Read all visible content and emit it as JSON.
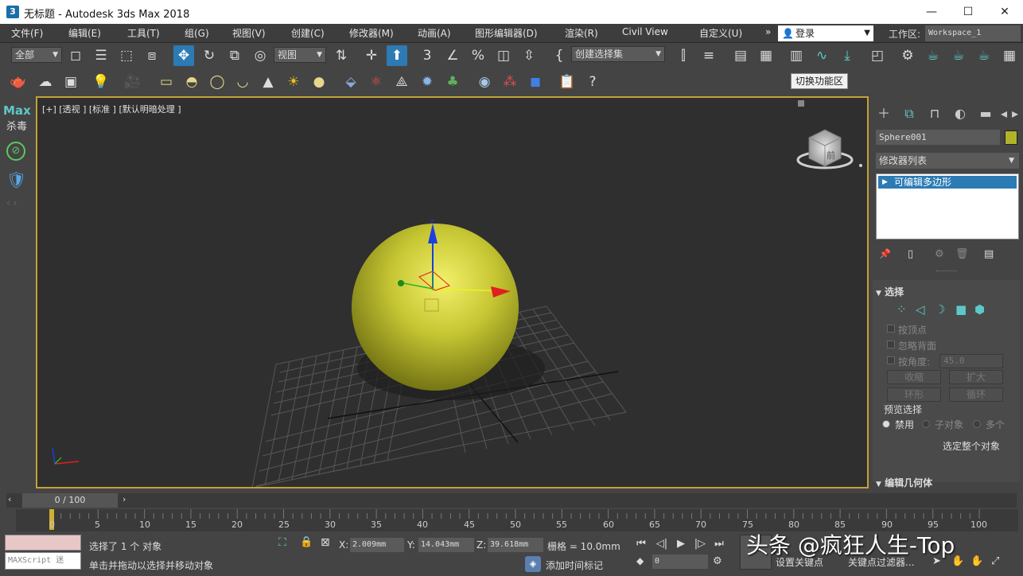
{
  "window": {
    "title": "无标题 - Autodesk 3ds Max 2018",
    "app_icon_text": "3"
  },
  "menu": [
    "文件(F)",
    "编辑(E)",
    "工具(T)",
    "组(G)",
    "视图(V)",
    "创建(C)",
    "修改器(M)",
    "动画(A)",
    "图形编辑器(D)",
    "渲染(R)",
    "Civil View",
    "自定义(U)"
  ],
  "menu_overflow": "»",
  "login": {
    "label": "登录"
  },
  "workspace": {
    "label": "工作区:",
    "value": "Workspace_1"
  },
  "toolbar": {
    "selection_filter": "全部",
    "reference_coord": "视图",
    "named_selection": "创建选择集",
    "tooltip": "切换功能区"
  },
  "left_strip": {
    "max_label": "Max",
    "sub_label": "杀毒"
  },
  "viewport": {
    "label": "[+] [透视 ] [标准 ] [默认明暗处理 ]",
    "gizmo_z": "z",
    "viewcube_face": "前",
    "object_color": "#b9bc2e",
    "border_color": "#c3a13a"
  },
  "command_panel": {
    "object_name": "Sphere001",
    "object_color": "#b1b32a",
    "modifier_list": "修改器列表",
    "stack_items": [
      "可编辑多边形"
    ],
    "selection": {
      "title": "选择",
      "by_vertex": "按顶点",
      "ignore_backfacing": "忽略背面",
      "by_angle": "按角度:",
      "angle_value": "45.0",
      "shrink": "收缩",
      "grow": "扩大",
      "ring": "环形",
      "loop": "循环",
      "preview_title": "预览选择",
      "preview_off": "禁用",
      "preview_sub": "子对象",
      "preview_multi": "多个",
      "select_whole": "选定整个对象"
    },
    "edit_geometry_title": "编辑几何体"
  },
  "timeline": {
    "slider": "0 / 100",
    "ticks": [
      "0",
      "5",
      "10",
      "15",
      "20",
      "25",
      "30",
      "35",
      "40",
      "45",
      "50",
      "55",
      "60",
      "65",
      "70",
      "75",
      "80",
      "85",
      "90",
      "95",
      "100"
    ]
  },
  "status": {
    "maxscript": "MAXScript 迷",
    "selected": "选择了 1 个 对象",
    "prompt": "单击并拖动以选择并移动对象",
    "x_label": "X:",
    "x": "2.009mm",
    "y_label": "Y:",
    "y": "14.043mm",
    "z_label": "Z:",
    "z": "39.618mm",
    "grid": "栅格 = 10.0mm",
    "add_time_tag": "添加时间标记",
    "frame": "0",
    "set_key": "设置关键点",
    "key_filters": "关键点过滤器..."
  },
  "watermark": "头条 @疯狂人生-Top"
}
